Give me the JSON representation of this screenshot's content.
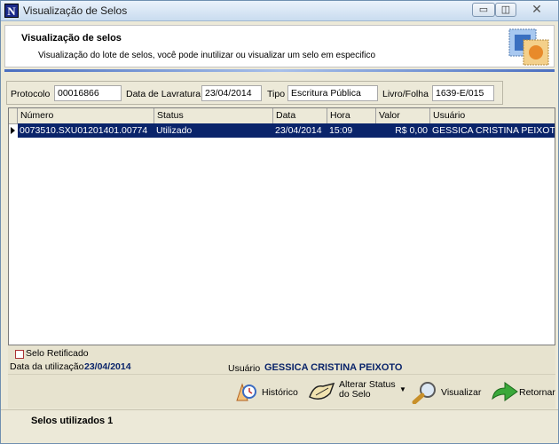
{
  "window": {
    "title": "Visualização de Selos",
    "min_label": "▭",
    "max_label": "◫",
    "close_label": "✕"
  },
  "header": {
    "title": "Visualização de selos",
    "subtitle": "Visualização do lote de selos, você pode inutilizar ou visualizar um selo em especifico"
  },
  "fields": {
    "protocolo_label": "Protocolo",
    "protocolo_value": "00016866",
    "data_lavratura_label": "Data de Lavratura",
    "data_lavratura_value": "23/04/2014",
    "tipo_label": "Tipo",
    "tipo_value": "Escritura Pública",
    "livro_label": "Livro/Folha",
    "livro_value": "1639-E/015"
  },
  "grid": {
    "columns": [
      "Número",
      "Status",
      "Data",
      "Hora",
      "Valor",
      "Usuário"
    ],
    "rows": [
      [
        "0073510.SXU01201401.00774",
        "Utilizado",
        "23/04/2014",
        "15:09",
        "R$ 0,00",
        "GESSICA CRISTINA PEIXOTO"
      ]
    ]
  },
  "details": {
    "selo_retificado_label": "Selo Retificado",
    "selo_retificado_checked": false,
    "data_utilizacao_label": "Data da utilização",
    "data_utilizacao_value": "23/04/2014",
    "usuario_label": "Usuário",
    "usuario_value": "GESSICA CRISTINA PEIXOTO"
  },
  "toolbar": {
    "historico_label": "Histórico",
    "alterar_line1": "Alterar Status",
    "alterar_line2": "do Selo",
    "visualizar_label": "Visualizar",
    "retornar_label": "Retornar"
  },
  "status": {
    "text": "Selos utilizados 1"
  },
  "colors": {
    "selection": "#0a246a",
    "accent_text": "#0a246a",
    "panel": "#ece9d8"
  },
  "icons": {
    "app": "app-n-icon",
    "historico": "historico-icon",
    "alterar": "alterar-status-icon",
    "visualizar": "magnifier-icon",
    "retornar": "green-arrow-icon"
  }
}
